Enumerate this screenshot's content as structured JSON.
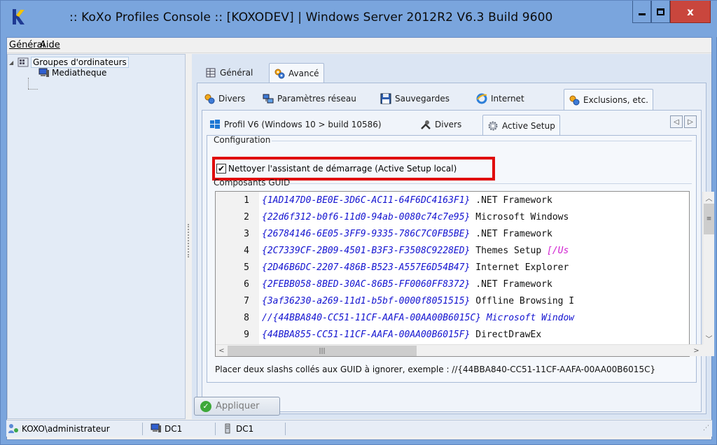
{
  "window": {
    "title": ":: KoXo Profiles Console :: [KOXODEV]  | Windows Server 2012R2 V6.3 Build 9600",
    "close_glyph": "x"
  },
  "menu": [
    "Général",
    "Aide"
  ],
  "tree": {
    "root": "Groupes d'ordinateurs",
    "child": "Mediatheque"
  },
  "tabs_level1": [
    {
      "label": "Général",
      "icon": "table-icon"
    },
    {
      "label": "Avancé",
      "icon": "gears-icon",
      "active": true
    }
  ],
  "tabs_level2": [
    {
      "label": "Divers",
      "icon": "gears-icon"
    },
    {
      "label": "Paramètres réseau",
      "icon": "network-icon"
    },
    {
      "label": "Sauvegardes",
      "icon": "floppy-icon"
    },
    {
      "label": "Internet",
      "icon": "ie-icon"
    },
    {
      "label": "Exclusions, etc.",
      "icon": "gears-icon",
      "active": true
    }
  ],
  "tabs_level3": [
    {
      "label": "Profil V6 (Windows 10 > build 10586)",
      "icon": "windows-icon"
    },
    {
      "label": "Divers",
      "icon": "tools-icon"
    },
    {
      "label": "Active Setup",
      "icon": "cog-icon",
      "active": true
    }
  ],
  "configuration": {
    "group_label": "Configuration",
    "checkbox_label": "Nettoyer l'assistant de démarrage (Active Setup local)",
    "checked": true
  },
  "guid_group": {
    "label": "Composants GUID",
    "lines": [
      {
        "n": "1",
        "guid": "{1AD147D0-BE0E-3D6C-AC11-64F6DC4163F1}",
        "text": " .NET Framework",
        "param": ""
      },
      {
        "n": "2",
        "guid": "{22d6f312-b0f6-11d0-94ab-0080c74c7e95}",
        "text": " Microsoft Windows",
        "param": ""
      },
      {
        "n": "3",
        "guid": "{26784146-6E05-3FF9-9335-786C7C0FB5BE}",
        "text": " .NET Framework",
        "param": ""
      },
      {
        "n": "4",
        "guid": "{2C7339CF-2B09-4501-B3F3-F3508C9228ED}",
        "text": " Themes Setup ",
        "param": "[/Us"
      },
      {
        "n": "5",
        "guid": "{2D46B6DC-2207-486B-B523-A557E6D54B47}",
        "text": " Internet Explorer",
        "param": ""
      },
      {
        "n": "6",
        "guid": "{2FEBB058-8BED-30AC-86B5-FF0060FF8372}",
        "text": " .NET Framework",
        "param": ""
      },
      {
        "n": "7",
        "guid": "{3af36230-a269-11d1-b5bf-0000f8051515}",
        "text": " Offline Browsing I",
        "param": ""
      },
      {
        "n": "8",
        "guid": "//{44BBA840-CC51-11CF-AAFA-00AA00B6015C} Microsoft Window",
        "text": "",
        "param": "",
        "commented": true
      },
      {
        "n": "9",
        "guid": "{44BBA855-CC51-11CF-AAFA-00AA00B6015F}",
        "text": " DirectDrawEx",
        "param": ""
      }
    ],
    "hint": "Placer deux slashs collés aux GUID à ignorer, exemple : //{44BBA840-CC51-11CF-AAFA-00AA00B6015C}"
  },
  "apply_button": "Appliquer",
  "statusbar": {
    "user": "KOXO\\administrateur",
    "computer": "DC1",
    "server": "DC1"
  },
  "colors": {
    "titlebar": "#7aa5dd",
    "highlight_border": "#e00b0b",
    "guid": "#1414d0",
    "param": "#d01ed0"
  }
}
